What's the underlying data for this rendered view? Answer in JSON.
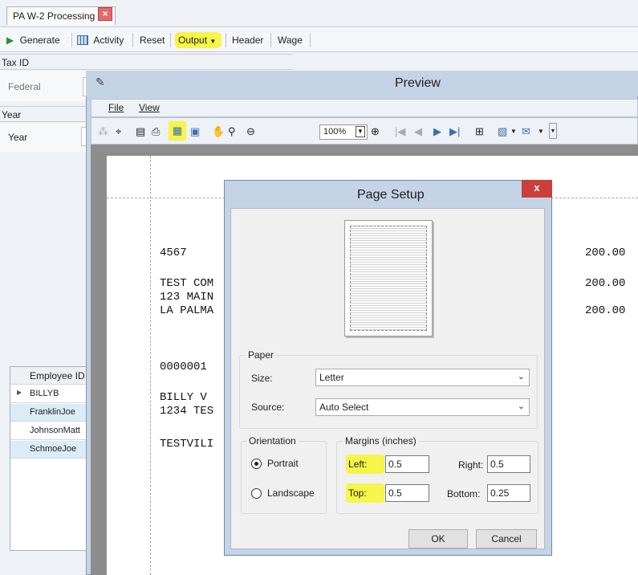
{
  "tab": {
    "title": "PA W-2 Processing",
    "close": "×"
  },
  "toolbar": {
    "generate": "Generate",
    "activity": "Activity",
    "reset": "Reset",
    "output": "Output",
    "header": "Header",
    "wage": "Wage"
  },
  "left_panel": {
    "tax_id_header": "Tax ID",
    "federal_label": "Federal",
    "year_header": "Year",
    "year_label": "Year"
  },
  "grid": {
    "column": "Employee ID",
    "rows": [
      "BILLYB",
      "FranklinJoe",
      "JohnsonMatt",
      "SchmoeJoe"
    ]
  },
  "preview": {
    "title": "Preview",
    "menu": [
      "File",
      "View"
    ],
    "zoom": "100%"
  },
  "report": {
    "lines": [
      "4567",
      "TEST COM",
      "123 MAIN",
      "LA PALMA",
      "0000001",
      "BILLY V",
      "1234 TES",
      "TESTVILI"
    ],
    "amounts": [
      "200.00",
      "200.00",
      "200.00"
    ]
  },
  "page_setup": {
    "title": "Page Setup",
    "close": "x",
    "paper_legend": "Paper",
    "size_label": "Size:",
    "size_value": "Letter",
    "source_label": "Source:",
    "source_value": "Auto Select",
    "orientation_legend": "Orientation",
    "portrait": "Portrait",
    "landscape": "Landscape",
    "margins_legend": "Margins (inches)",
    "left_label": "Left:",
    "left_value": "0.5",
    "right_label": "Right:",
    "right_value": "0.5",
    "top_label": "Top:",
    "top_value": "0.5",
    "bottom_label": "Bottom:",
    "bottom_value": "0.25",
    "ok": "OK",
    "cancel": "Cancel"
  },
  "colors": {
    "highlight": "#f7f44a",
    "window_frame": "#c5d3e6",
    "close_red": "#c9403a"
  }
}
